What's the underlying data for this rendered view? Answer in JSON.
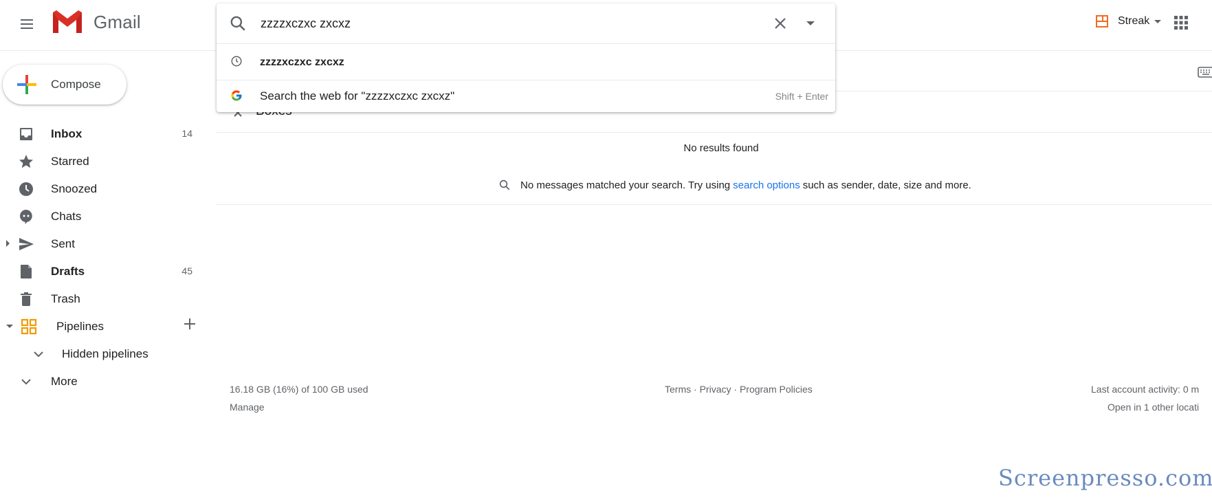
{
  "app": {
    "name": "Gmail",
    "streak_label": "Streak"
  },
  "search": {
    "query": "zzzzxczxc zxcxz",
    "suggestions": {
      "recent": "zzzzxczxc zxcxz",
      "web": "Search the web for \"zzzzxczxc zxcxz\"",
      "web_hint": "Shift + Enter"
    }
  },
  "compose": {
    "label": "Compose"
  },
  "sidebar": {
    "items": [
      {
        "label": "Inbox",
        "count": "14",
        "icon": "inbox-icon",
        "bold": true
      },
      {
        "label": "Starred",
        "count": "",
        "icon": "star-icon"
      },
      {
        "label": "Snoozed",
        "count": "",
        "icon": "clock-icon"
      },
      {
        "label": "Chats",
        "count": "",
        "icon": "chat-icon"
      },
      {
        "label": "Sent",
        "count": "",
        "icon": "send-icon"
      },
      {
        "label": "Drafts",
        "count": "45",
        "icon": "draft-icon",
        "bold": true
      },
      {
        "label": "Trash",
        "count": "",
        "icon": "trash-icon"
      },
      {
        "label": "Pipelines",
        "count": "",
        "icon": "pipelines-icon"
      },
      {
        "label": "Hidden pipelines",
        "count": "",
        "icon": "chevron-down-icon"
      },
      {
        "label": "More",
        "count": "",
        "icon": "chevron-down-icon"
      }
    ]
  },
  "main": {
    "section_label": "Boxes",
    "no_results": "No results found",
    "no_messages_prefix": "No messages matched your search. Try using",
    "no_messages_link": "search options",
    "no_messages_suffix": "such as sender, date, size and more."
  },
  "footer": {
    "storage": "16.18 GB (16%) of 100 GB used",
    "manage": "Manage",
    "terms": "Terms",
    "privacy": "Privacy",
    "program_policies": "Program Policies",
    "separator": " · ",
    "last_activity": "Last account activity: 0 m",
    "open_in": "Open in 1 other locati"
  },
  "watermark": "Screenpresso.com",
  "colors": {
    "accent_blue": "#1a73e8",
    "gmail_red": "#d93025",
    "streak_orange": "#f26b21",
    "icon_gray": "#5f6368"
  }
}
